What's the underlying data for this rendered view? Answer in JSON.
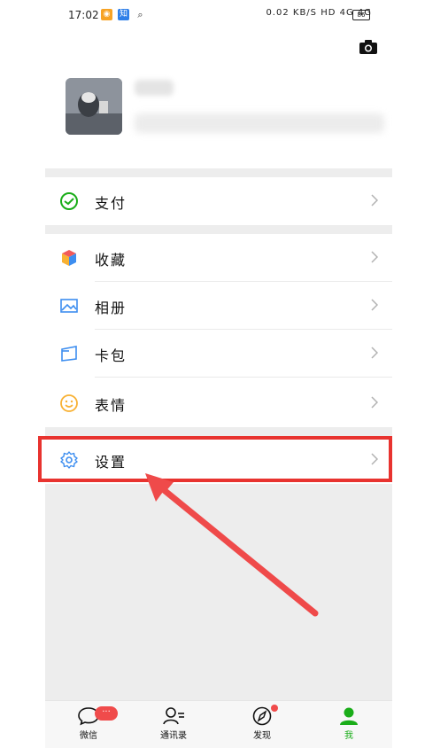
{
  "status_bar": {
    "time": "17:02",
    "right_text": "0.02 KB/S HD 4G 4G",
    "battery": "86"
  },
  "menu": {
    "pay": "支付",
    "favorites": "收藏",
    "album": "相册",
    "cards": "卡包",
    "stickers": "表情",
    "settings": "设置"
  },
  "tabbar": {
    "chats": "微信",
    "contacts": "通讯录",
    "discover": "发现",
    "me": "我",
    "chats_badge": "···"
  },
  "colors": {
    "accent": "#1aad19",
    "highlight": "#e8332f",
    "badge": "#f04b4b",
    "background": "#ededed"
  },
  "icons": {
    "camera": "camera-icon",
    "pay": "wechat-pay-icon",
    "favorites": "cube-icon",
    "album": "picture-icon",
    "cards": "card-icon",
    "stickers": "smiley-icon",
    "settings": "gear-icon"
  }
}
